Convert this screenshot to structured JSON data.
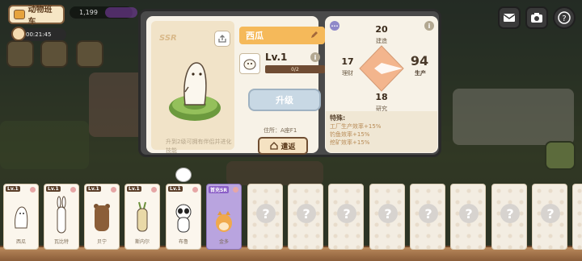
{
  "hud": {
    "bus_label": "动物班车",
    "timer": "00:21:45",
    "coins": "1,199"
  },
  "modal": {
    "rarity": "SSR",
    "name": "西瓜",
    "level": "Lv.1",
    "xp": "0/2",
    "upgrade_label": "升级",
    "description": "升到2级可拥有伴侣并进化技能",
    "home": "住所：A座F1",
    "return_label": "遣返",
    "stats": {
      "top_value": "20",
      "top_label": "建造",
      "left_value": "17",
      "left_label": "理财",
      "right_value": "94",
      "right_label": "生产",
      "bottom_value": "18",
      "bottom_label": "研究"
    },
    "special_title": "特殊:",
    "special_lines": [
      "工厂生产效率+15%",
      "钓鱼效率+15%",
      "挖矿效率+15%"
    ]
  },
  "cards": [
    {
      "level": "Lv.1",
      "name": "西瓜"
    },
    {
      "level": "Lv.1",
      "name": "瓦比特"
    },
    {
      "level": "Lv.1",
      "name": "贝宁"
    },
    {
      "level": "Lv.1",
      "name": "斯内尔"
    },
    {
      "level": "Lv.1",
      "name": "布鲁"
    },
    {
      "level": "首充SR",
      "name": "金多"
    }
  ],
  "colors": {
    "accent": "#f5b95a",
    "stat_shape": "#f3b58d",
    "shelf": "#b9895c"
  }
}
